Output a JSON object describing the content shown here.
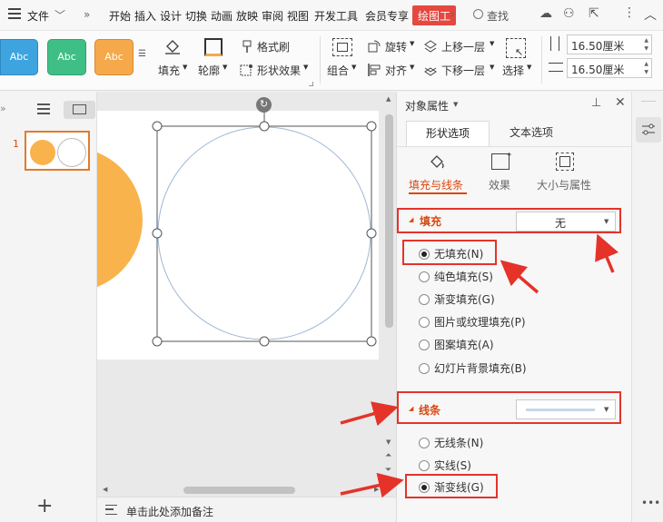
{
  "menu": {
    "file": "文件",
    "tabs": [
      "开始",
      "插入",
      "设计",
      "切换",
      "动画",
      "放映",
      "审阅",
      "视图",
      "开发工具",
      "会员专享"
    ],
    "active_tab": "绘图工",
    "search": "查找"
  },
  "ribbon": {
    "styles": [
      {
        "label": "Abc",
        "color": "#3ea4e0"
      },
      {
        "label": "Abc",
        "color": "#3fbf86"
      },
      {
        "label": "Abc",
        "color": "#f6a94a"
      }
    ],
    "fill": "填充",
    "outline": "轮廓",
    "format_painter": "格式刷",
    "shape_effect": "形状效果",
    "group": "组合",
    "rotate": "旋转",
    "align": "对齐",
    "bring_forward": "上移一层",
    "send_backward": "下移一层",
    "select": "选择",
    "height": "16.50厘米",
    "width": "16.50厘米"
  },
  "thumbnail": {
    "number": "1"
  },
  "notes": {
    "placeholder": "单击此处添加备注"
  },
  "panel": {
    "title": "对象属性",
    "tabs": {
      "shape": "形状选项",
      "text": "文本选项"
    },
    "subtabs": {
      "fill_line": "填充与线条",
      "effect": "效果",
      "size": "大小与属性"
    },
    "fill_section": {
      "title": "填充",
      "dropdown_value": "无",
      "options": [
        "无填充(N)",
        "纯色填充(S)",
        "渐变填充(G)",
        "图片或纹理填充(P)",
        "图案填充(A)",
        "幻灯片背景填充(B)"
      ]
    },
    "line_section": {
      "title": "线条",
      "options": [
        "无线条(N)",
        "实线(S)",
        "渐变线(G)"
      ]
    }
  },
  "colors": {
    "accent": "#e5483f",
    "orange": "#f9b34c",
    "highlight": "#e5332a"
  }
}
